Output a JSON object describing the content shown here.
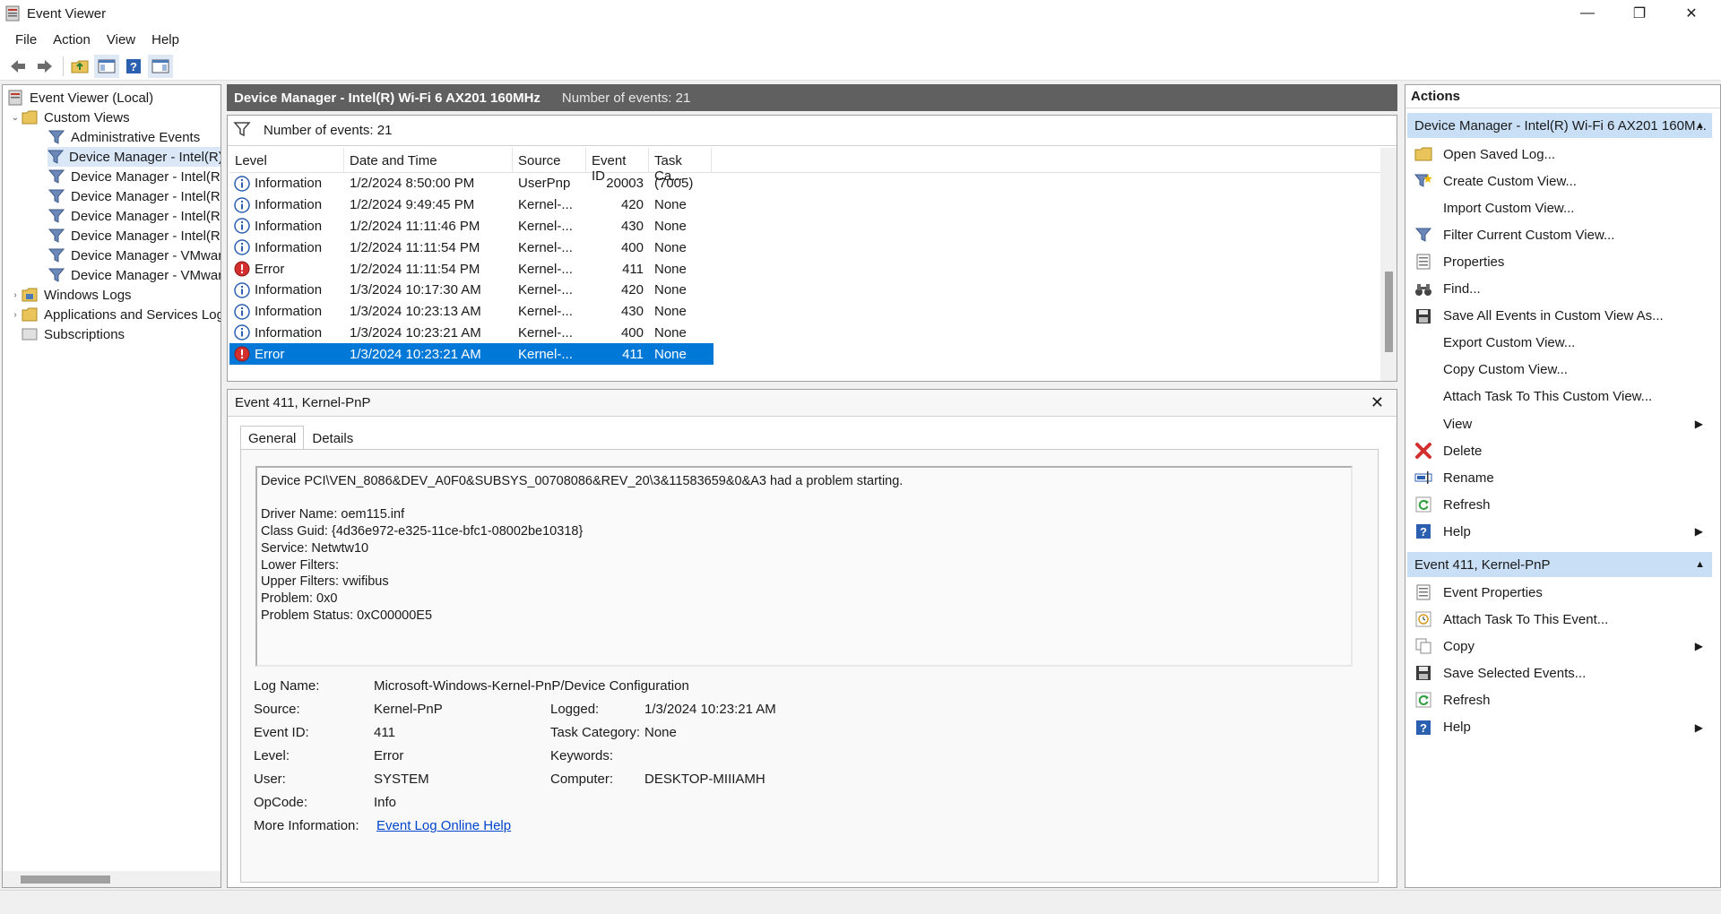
{
  "window": {
    "title": "Event Viewer",
    "minimize": "—",
    "maximize": "❐",
    "close": "✕"
  },
  "menu": [
    "File",
    "Action",
    "View",
    "Help"
  ],
  "tree": {
    "root": "Event Viewer (Local)",
    "custom_views": "Custom Views",
    "children": [
      "Administrative Events",
      "Device Manager - Intel(R)",
      "Device Manager - Intel(R)",
      "Device Manager - Intel(R)",
      "Device Manager - Intel(R)",
      "Device Manager - Intel(R)",
      "Device Manager - VMwar",
      "Device Manager - VMwar"
    ],
    "windows_logs": "Windows Logs",
    "app_services": "Applications and Services Log",
    "subscriptions": "Subscriptions"
  },
  "center": {
    "header_title": "Device Manager - Intel(R) Wi-Fi 6 AX201 160MHz",
    "header_count": "Number of events: 21",
    "filter_text": "Number of events: 21",
    "columns": [
      "Level",
      "Date and Time",
      "Source",
      "Event ID",
      "Task Ca..."
    ],
    "rows": [
      {
        "level": "Information",
        "date": "1/2/2024 8:50:00 PM",
        "source": "UserPnp",
        "id": "20003",
        "task": "(7005)",
        "type": "info"
      },
      {
        "level": "Information",
        "date": "1/2/2024 9:49:45 PM",
        "source": "Kernel-...",
        "id": "420",
        "task": "None",
        "type": "info"
      },
      {
        "level": "Information",
        "date": "1/2/2024 11:11:46 PM",
        "source": "Kernel-...",
        "id": "430",
        "task": "None",
        "type": "info"
      },
      {
        "level": "Information",
        "date": "1/2/2024 11:11:54 PM",
        "source": "Kernel-...",
        "id": "400",
        "task": "None",
        "type": "info"
      },
      {
        "level": "Error",
        "date": "1/2/2024 11:11:54 PM",
        "source": "Kernel-...",
        "id": "411",
        "task": "None",
        "type": "error"
      },
      {
        "level": "Information",
        "date": "1/3/2024 10:17:30 AM",
        "source": "Kernel-...",
        "id": "420",
        "task": "None",
        "type": "info"
      },
      {
        "level": "Information",
        "date": "1/3/2024 10:23:13 AM",
        "source": "Kernel-...",
        "id": "430",
        "task": "None",
        "type": "info"
      },
      {
        "level": "Information",
        "date": "1/3/2024 10:23:21 AM",
        "source": "Kernel-...",
        "id": "400",
        "task": "None",
        "type": "info"
      },
      {
        "level": "Error",
        "date": "1/3/2024 10:23:21 AM",
        "source": "Kernel-...",
        "id": "411",
        "task": "None",
        "type": "error"
      }
    ]
  },
  "detail": {
    "title": "Event 411, Kernel-PnP",
    "tabs": [
      "General",
      "Details"
    ],
    "message": "Device PCI\\VEN_8086&DEV_A0F0&SUBSYS_00708086&REV_20\\3&11583659&0&A3 had a problem starting.\n\nDriver Name: oem115.inf\nClass Guid: {4d36e972-e325-11ce-bfc1-08002be10318}\nService: Netwtw10\nLower Filters:\nUpper Filters: vwifibus\nProblem: 0x0\nProblem Status: 0xC00000E5",
    "labels": {
      "log_name": "Log Name:",
      "source": "Source:",
      "event_id": "Event ID:",
      "level": "Level:",
      "user": "User:",
      "opcode": "OpCode:",
      "more_info": "More Information:",
      "logged": "Logged:",
      "task_category": "Task Category:",
      "keywords": "Keywords:",
      "computer": "Computer:"
    },
    "values": {
      "log_name": "Microsoft-Windows-Kernel-PnP/Device Configuration",
      "source": "Kernel-PnP",
      "event_id": "411",
      "level": "Error",
      "user": "SYSTEM",
      "opcode": "Info",
      "more_info_link": "Event Log Online Help",
      "logged": "1/3/2024 10:23:21 AM",
      "task_category": "None",
      "keywords": "",
      "computer": "DESKTOP-MIIIAMH"
    }
  },
  "actions": {
    "title": "Actions",
    "section1": "Device Manager - Intel(R) Wi-Fi 6 AX201 160M...",
    "items1": [
      {
        "label": "Open Saved Log...",
        "icon": "folder-icon"
      },
      {
        "label": "Create Custom View...",
        "icon": "filter-star-icon"
      },
      {
        "label": "Import Custom View...",
        "icon": ""
      },
      {
        "label": "Filter Current Custom View...",
        "icon": "filter-icon"
      },
      {
        "label": "Properties",
        "icon": "properties-icon"
      },
      {
        "label": "Find...",
        "icon": "binoculars-icon"
      },
      {
        "label": "Save All Events in Custom View As...",
        "icon": "save-icon"
      },
      {
        "label": "Export Custom View...",
        "icon": ""
      },
      {
        "label": "Copy Custom View...",
        "icon": ""
      },
      {
        "label": "Attach Task To This Custom View...",
        "icon": ""
      },
      {
        "label": "View",
        "icon": "",
        "submenu": true
      },
      {
        "label": "Delete",
        "icon": "delete-icon"
      },
      {
        "label": "Rename",
        "icon": "rename-icon"
      },
      {
        "label": "Refresh",
        "icon": "refresh-icon"
      },
      {
        "label": "Help",
        "icon": "help-icon",
        "submenu": true
      }
    ],
    "section2": "Event 411, Kernel-PnP",
    "items2": [
      {
        "label": "Event Properties",
        "icon": "properties-icon"
      },
      {
        "label": "Attach Task To This Event...",
        "icon": "task-icon"
      },
      {
        "label": "Copy",
        "icon": "copy-icon",
        "submenu": true
      },
      {
        "label": "Save Selected Events...",
        "icon": "save-icon"
      },
      {
        "label": "Refresh",
        "icon": "refresh-icon"
      },
      {
        "label": "Help",
        "icon": "help-icon",
        "submenu": true
      }
    ]
  }
}
